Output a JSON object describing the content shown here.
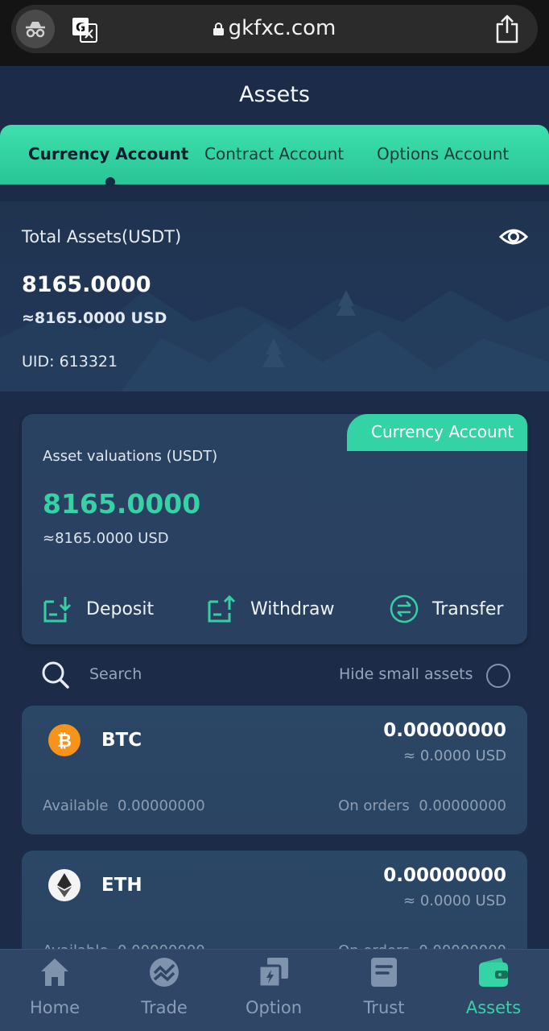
{
  "browser": {
    "url": "gkfxc.com"
  },
  "page": {
    "title": "Assets"
  },
  "tabs": [
    {
      "label": "Currency Account",
      "active": true
    },
    {
      "label": "Contract Account",
      "active": false
    },
    {
      "label": "Options Account",
      "active": false
    }
  ],
  "summary": {
    "total_label": "Total Assets(USDT)",
    "total_value": "8165.0000",
    "total_usd": "≈8165.0000 USD",
    "uid": "UID: 613321"
  },
  "valuation": {
    "badge": "Currency Account",
    "label": "Asset valuations (USDT)",
    "amount": "8165.0000",
    "usd": "≈8165.0000 USD",
    "actions": [
      {
        "label": "Deposit",
        "icon": "deposit-icon"
      },
      {
        "label": "Withdraw",
        "icon": "withdraw-icon"
      },
      {
        "label": "Transfer",
        "icon": "transfer-icon"
      }
    ]
  },
  "search": {
    "placeholder": "Search",
    "hide_small_label": "Hide small assets"
  },
  "coins": [
    {
      "symbol": "BTC",
      "amount": "0.00000000",
      "usd": "≈ 0.0000 USD",
      "available_label": "Available",
      "available": "0.00000000",
      "orders_label": "On orders",
      "orders": "0.00000000",
      "icon": "bitcoin-icon"
    },
    {
      "symbol": "ETH",
      "amount": "0.00000000",
      "usd": "≈ 0.0000 USD",
      "available_label": "Available",
      "available": "0.00000000",
      "orders_label": "On orders",
      "orders": "0.00000000",
      "icon": "ethereum-icon"
    }
  ],
  "nav": [
    {
      "label": "Home",
      "icon": "home-icon",
      "active": false
    },
    {
      "label": "Trade",
      "icon": "trade-icon",
      "active": false
    },
    {
      "label": "Option",
      "icon": "option-icon",
      "active": false
    },
    {
      "label": "Trust",
      "icon": "trust-icon",
      "active": false
    },
    {
      "label": "Assets",
      "icon": "wallet-icon",
      "active": true
    }
  ],
  "colors": {
    "accent": "#35d3a5",
    "background": "#1c2b48",
    "card": "#2a4262",
    "bitcoin": "#f7931a"
  }
}
